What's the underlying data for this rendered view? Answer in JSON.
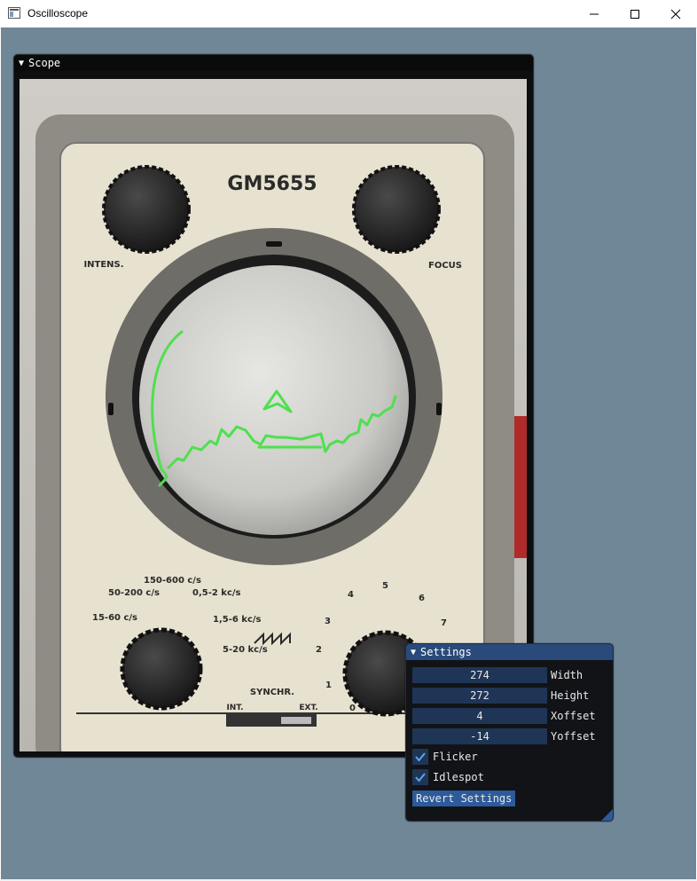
{
  "window": {
    "title": "Oscilloscope"
  },
  "scope": {
    "title": "Scope",
    "device": {
      "model": "GM5655",
      "intens_label": "INTENS.",
      "focus_label": "FOCUS",
      "synchr_label": "SYNCHR.",
      "int_label": "INT.",
      "ext_label": "EXT.",
      "range_labels": [
        "15-60 c/s",
        "50-200 c/s",
        "150-600 c/s",
        "0,5-2 kc/s",
        "1,5-6 kc/s",
        "5-20 kc/s"
      ],
      "dial_numbers": [
        "0",
        "1",
        "2",
        "3",
        "4",
        "5",
        "6",
        "7"
      ]
    },
    "trace_color": "#4ee04e"
  },
  "settings": {
    "title": "Settings",
    "fields": [
      {
        "label": "Width",
        "value": "274"
      },
      {
        "label": "Height",
        "value": "272"
      },
      {
        "label": "Xoffset",
        "value": "4"
      },
      {
        "label": "Yoffset",
        "value": "-14"
      }
    ],
    "checkboxes": [
      {
        "label": "Flicker",
        "checked": true
      },
      {
        "label": "Idlespot",
        "checked": true
      }
    ],
    "revert_label": "Revert Settings"
  },
  "colors": {
    "desktop": "#6f8797",
    "imgui_title_active": "#294a7a",
    "imgui_frame": "#1f3556",
    "imgui_button": "#2c5a9a"
  }
}
